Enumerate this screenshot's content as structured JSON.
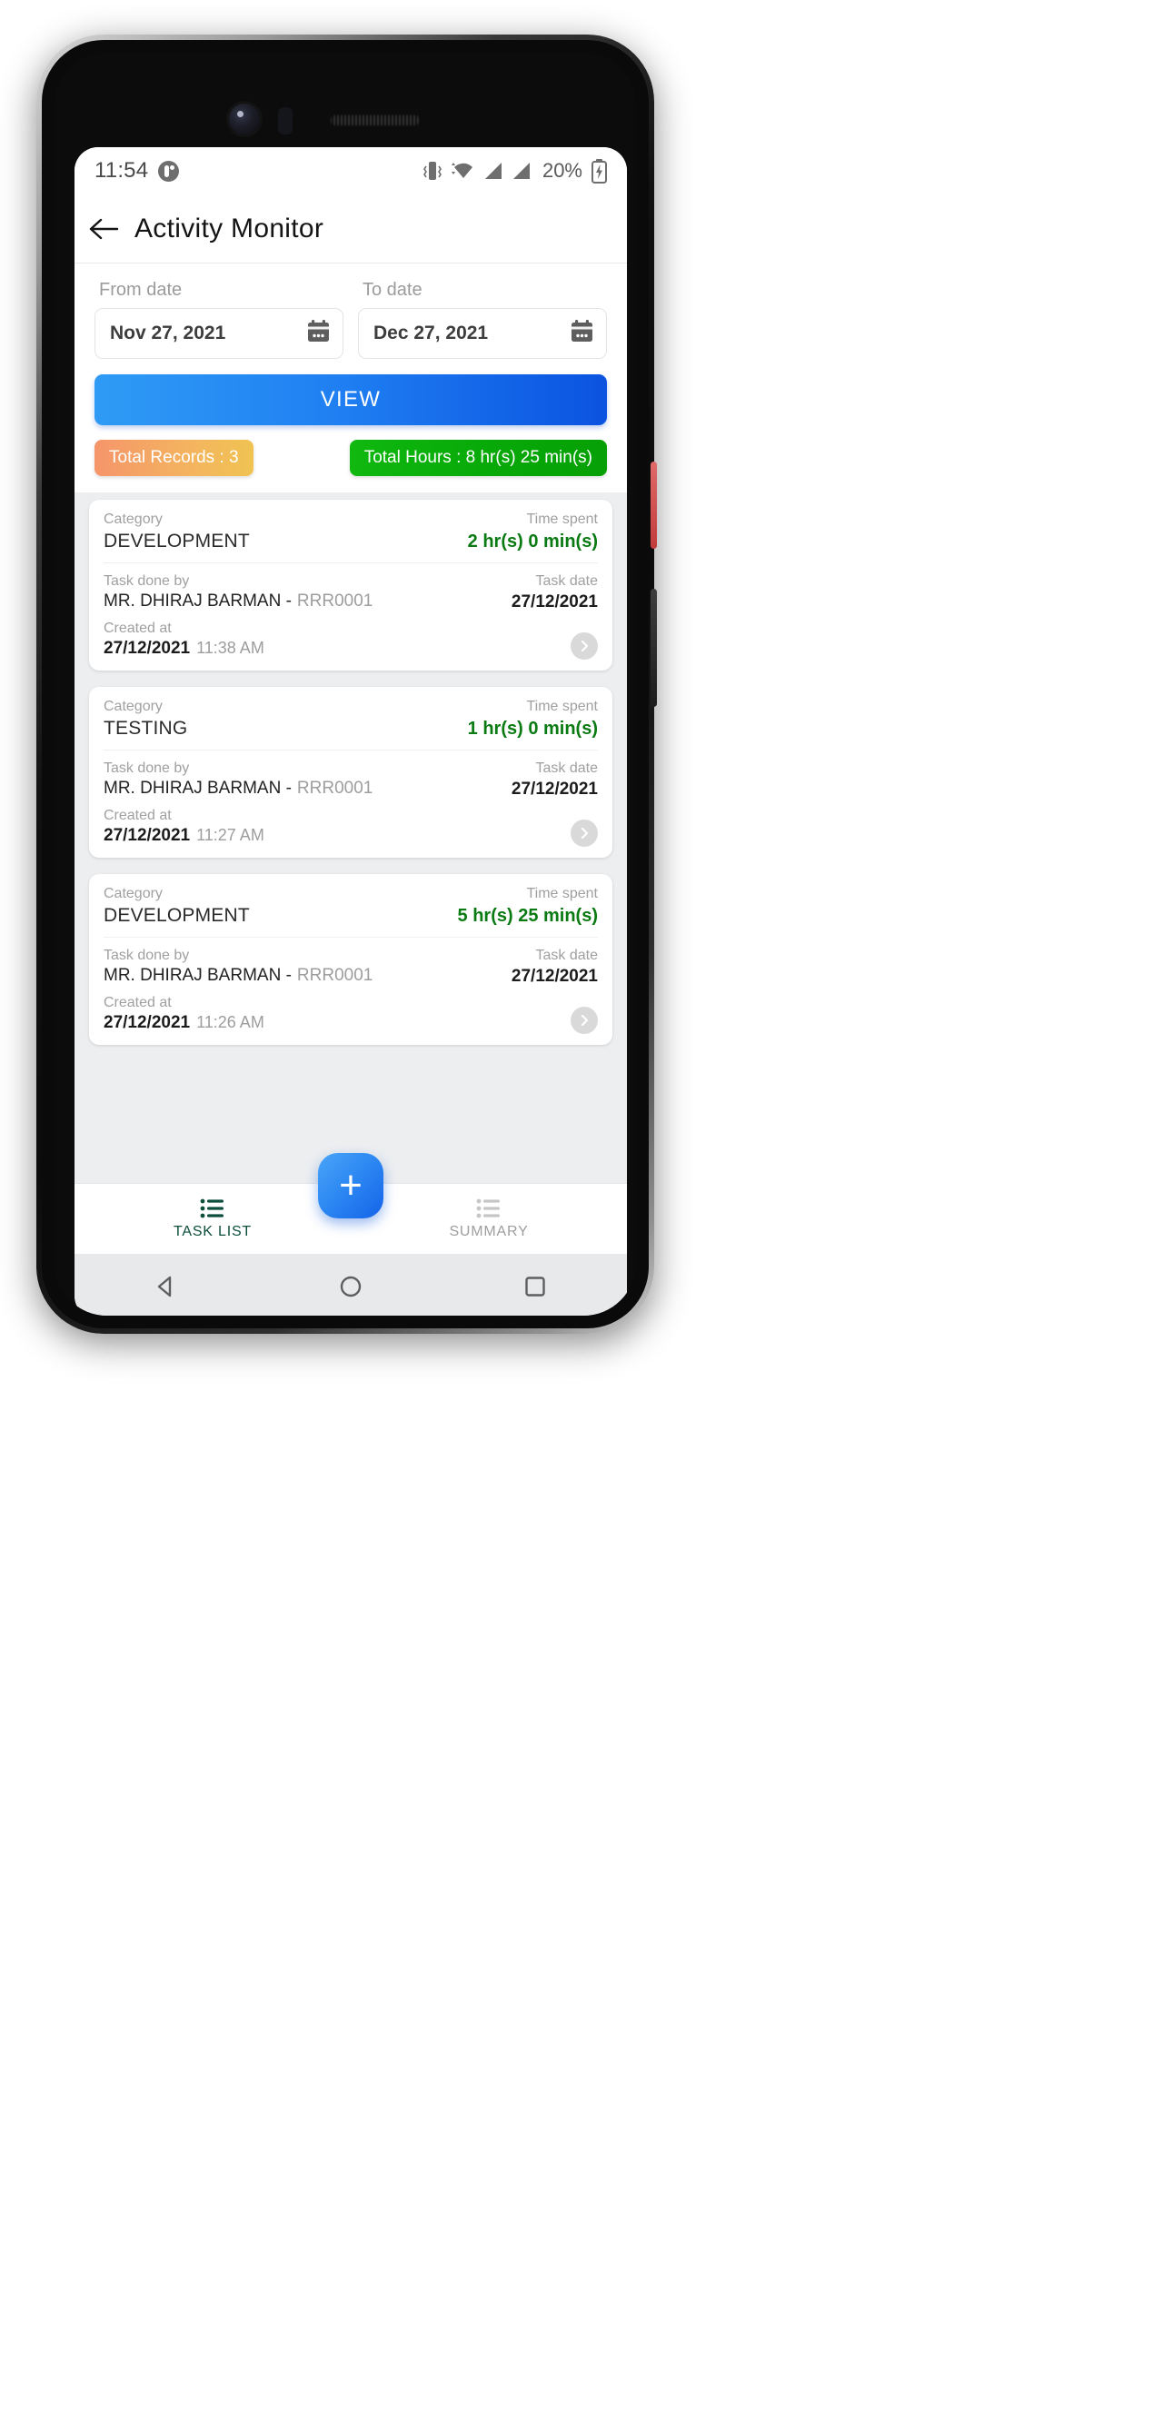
{
  "status_bar": {
    "time": "11:54",
    "battery_percent": "20%",
    "icons": [
      "notification-dot-icon",
      "vibrate-icon",
      "wifi-icon",
      "signal-bar-icon",
      "signal-bar-icon",
      "battery-charging-icon"
    ]
  },
  "app_bar": {
    "back_label": "←",
    "title": "Activity Monitor"
  },
  "filters": {
    "from_label": "From date",
    "from_value": "Nov 27, 2021",
    "to_label": "To date",
    "to_value": "Dec 27, 2021",
    "view_button": "VIEW"
  },
  "summary_badges": {
    "records": "Total Records : 3",
    "hours": "Total Hours : 8 hr(s) 25 min(s)",
    "records_color": "#f4a85f",
    "hours_color": "#08ab08"
  },
  "labels": {
    "category": "Category",
    "time_spent": "Time spent",
    "task_done_by": "Task done by",
    "task_date": "Task date",
    "created_at": "Created at"
  },
  "tasks": [
    {
      "category": "DEVELOPMENT",
      "time_spent": "2 hr(s) 0 min(s)",
      "person": "MR. DHIRAJ  BARMAN -",
      "employee_id": "RRR0001",
      "task_date": "27/12/2021",
      "created_date": "27/12/2021",
      "created_time": "11:38 AM"
    },
    {
      "category": "TESTING",
      "time_spent": "1 hr(s) 0 min(s)",
      "person": "MR. DHIRAJ  BARMAN -",
      "employee_id": "RRR0001",
      "task_date": "27/12/2021",
      "created_date": "27/12/2021",
      "created_time": "11:27 AM"
    },
    {
      "category": "DEVELOPMENT",
      "time_spent": "5 hr(s) 25 min(s)",
      "person": "MR. DHIRAJ  BARMAN -",
      "employee_id": "RRR0001",
      "task_date": "27/12/2021",
      "created_date": "27/12/2021",
      "created_time": "11:26 AM"
    }
  ],
  "bottom_nav": {
    "tabs": [
      {
        "label": "TASK LIST",
        "active": true
      },
      {
        "label": "SUMMARY",
        "active": false
      }
    ],
    "fab_label": "+"
  }
}
